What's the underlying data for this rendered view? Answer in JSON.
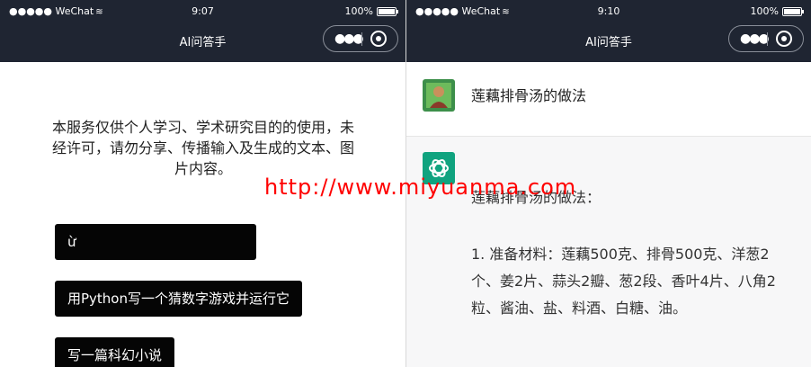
{
  "left": {
    "status": {
      "carrier": "●●●●● WeChat",
      "time": "9:07",
      "battery": "100%"
    },
    "title": "AI问答手",
    "disclaimer": "本服务仅供个人学习、学术研究目的的使用，未经许可，请勿分享、传播输入及生成的文本、图片内容。",
    "examples": [
      "ừ",
      "用Python写一个猜数字游戏并运行它",
      "写一篇科幻小说"
    ]
  },
  "right": {
    "status": {
      "carrier": "●●●●● WeChat",
      "time": "9:10",
      "battery": "100%"
    },
    "title": "AI问答手",
    "question": "莲藕排骨汤的做法",
    "answer_title": "莲藕排骨汤的做法：",
    "answer_body": "1. 准备材料：莲藕500克、排骨500克、洋葱2个、姜2片、蒜头2瓣、葱2段、香叶4片、八角2粒、酱油、盐、料酒、白糖、油。"
  },
  "watermark": "http://www.miyuanma.com",
  "colors": {
    "topbar": "#1f2532",
    "example_bg": "#050505",
    "answer_bg": "#f7f7f8",
    "openai_green": "#10a37f",
    "watermark": "#ff0000"
  },
  "icons": {
    "more": "more-dots-icon",
    "close": "target-icon",
    "wifi": "wifi-icon",
    "battery": "battery-icon"
  }
}
